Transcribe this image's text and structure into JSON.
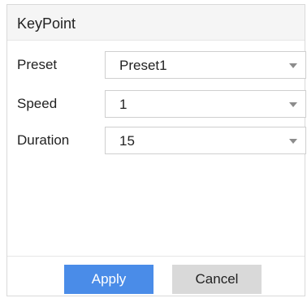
{
  "dialog": {
    "title": "KeyPoint"
  },
  "form": {
    "preset": {
      "label": "Preset",
      "value": "Preset1"
    },
    "speed": {
      "label": "Speed",
      "value": "1"
    },
    "duration": {
      "label": "Duration",
      "value": "15"
    }
  },
  "buttons": {
    "apply_label": "Apply",
    "cancel_label": "Cancel"
  },
  "icons": {
    "dropdown": "chevron-down-icon"
  },
  "colors": {
    "accent": "#4a8ce8",
    "secondary_button": "#d9d9d9"
  }
}
